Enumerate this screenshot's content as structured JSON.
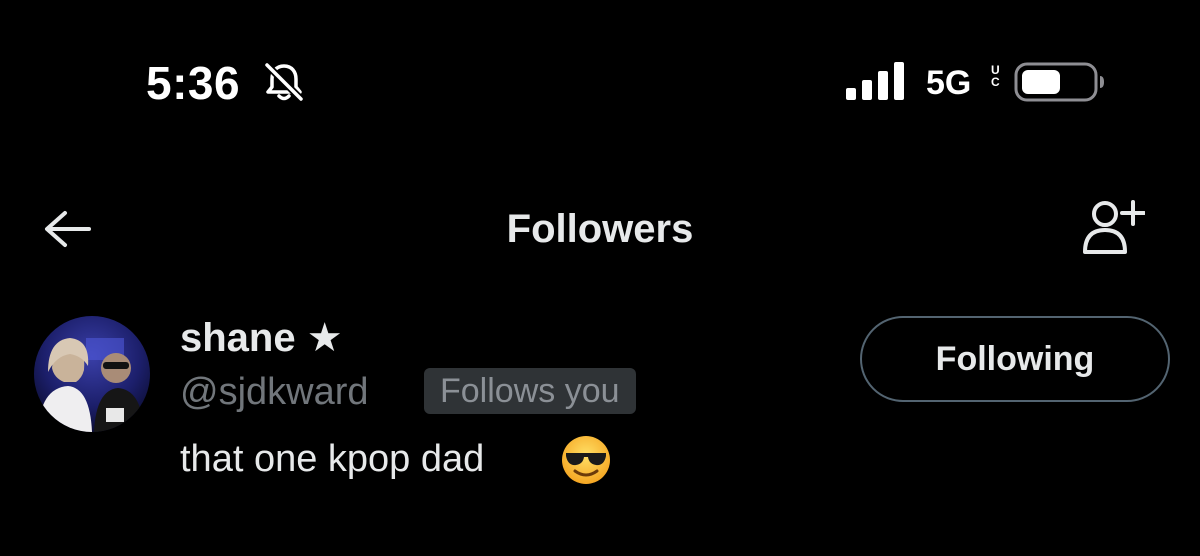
{
  "status_bar": {
    "time": "5:36",
    "network": "5G",
    "network_suffix_top": "U",
    "network_suffix_bottom": "C",
    "icons": [
      "bell-slash-icon",
      "signal-icon",
      "battery-icon"
    ]
  },
  "nav": {
    "title": "Followers",
    "back_icon": "arrow-left-icon",
    "add_icon": "person-plus-icon"
  },
  "follower": {
    "name": "shane ★",
    "handle": "@sjdkward",
    "badge": "Follows you",
    "bio": "that one kpop dad",
    "bio_emoji": "smiling-face-with-sunglasses",
    "button_label": "Following"
  },
  "colors": {
    "background": "#000000",
    "primary_text": "#e7e9ea",
    "secondary_text": "#71767b",
    "badge_bg": "#2f3336",
    "button_border": "#536471"
  }
}
